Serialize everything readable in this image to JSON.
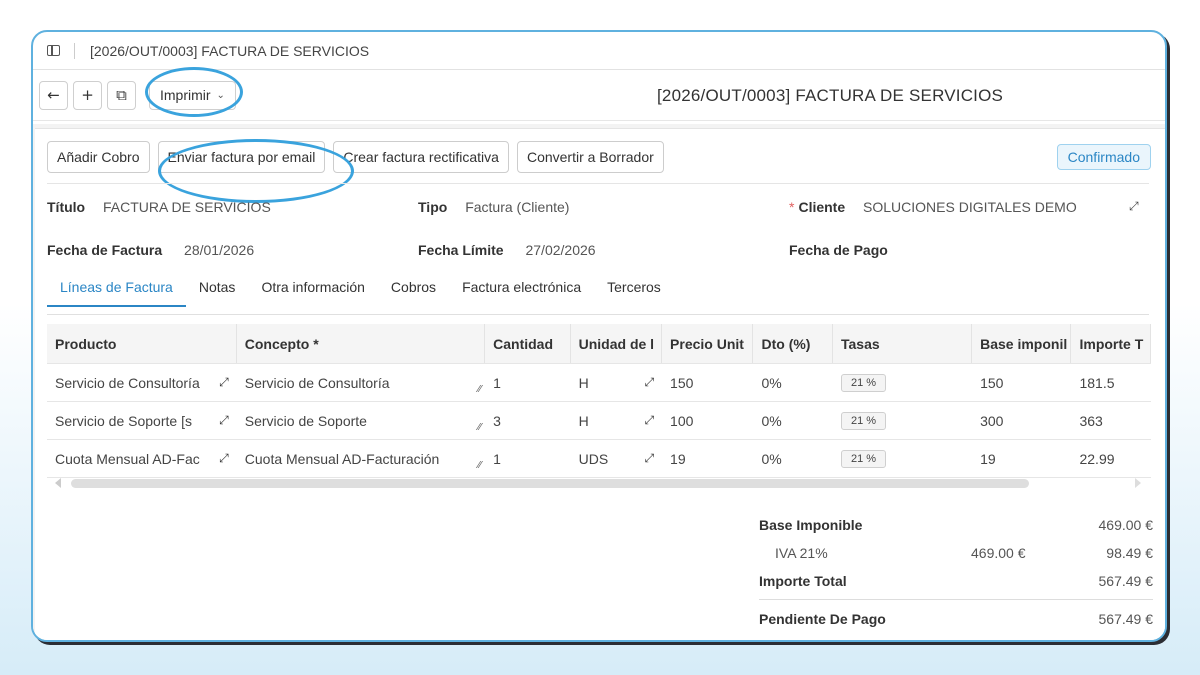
{
  "window": {
    "title": "[2026/OUT/0003] FACTURA DE SERVICIOS"
  },
  "toolbar": {
    "back_glyph": "←",
    "add_glyph": "+",
    "duplicate_glyph": "⧉",
    "print_label": "Imprimir",
    "print_chevron": "⌄",
    "document_title": "[2026/OUT/0003] FACTURA DE SERVICIOS"
  },
  "actions": {
    "add_payment": "Añadir Cobro",
    "send_email": "Enviar factura por email",
    "credit_note": "Crear factura rectificativa",
    "to_draft": "Convertir a Borrador"
  },
  "status": {
    "label": "Confirmado",
    "color": "#2b86c5"
  },
  "fields": {
    "title_label": "Título",
    "title_value": "FACTURA DE SERVICIOS",
    "type_label": "Tipo",
    "type_value": "Factura (Cliente)",
    "client_required": "*",
    "client_label": "Cliente",
    "client_value": "SOLUCIONES DIGITALES DEMO",
    "date_label": "Fecha de Factura",
    "date_value": "28/01/2026",
    "due_label": "Fecha Límite",
    "due_value": "27/02/2026",
    "paydate_label": "Fecha de Pago"
  },
  "tabs": [
    {
      "label": "Líneas de Factura",
      "active": true
    },
    {
      "label": "Notas"
    },
    {
      "label": "Otra información"
    },
    {
      "label": "Cobros"
    },
    {
      "label": "Factura electrónica"
    },
    {
      "label": "Terceros"
    }
  ],
  "grid": {
    "columns": [
      "Producto",
      "Concepto *",
      "Cantidad",
      "Unidad de l",
      "Precio Unit",
      "Dto (%)",
      "Tasas",
      "Base imponil",
      "Importe T"
    ],
    "rows": [
      {
        "product": "Servicio de Consultoría",
        "concept": "Servicio de Consultoría",
        "qty": "1",
        "unit": "H",
        "price": "150",
        "discount": "0%",
        "tax": "21 %",
        "base": "150",
        "total": "181.5"
      },
      {
        "product": "Servicio de Soporte [s",
        "concept": "Servicio de Soporte",
        "qty": "3",
        "unit": "H",
        "price": "100",
        "discount": "0%",
        "tax": "21 %",
        "base": "300",
        "total": "363"
      },
      {
        "product": "Cuota Mensual AD-Fac",
        "concept": "Cuota Mensual AD-Facturación",
        "qty": "1",
        "unit": "UDS",
        "price": "19",
        "discount": "0%",
        "tax": "21 %",
        "base": "19",
        "total": "22.99"
      }
    ]
  },
  "totals": {
    "base_label": "Base Imponible",
    "base_value": "469.00 €",
    "vat_label": "IVA 21%",
    "vat_base": "469.00 €",
    "vat_value": "98.49 €",
    "total_label": "Importe Total",
    "total_value": "567.49 €",
    "pending_label": "Pendiente De Pago",
    "pending_value": "567.49 €"
  },
  "colors": {
    "accent": "#3aa3dd",
    "link": "#2b86c5"
  }
}
